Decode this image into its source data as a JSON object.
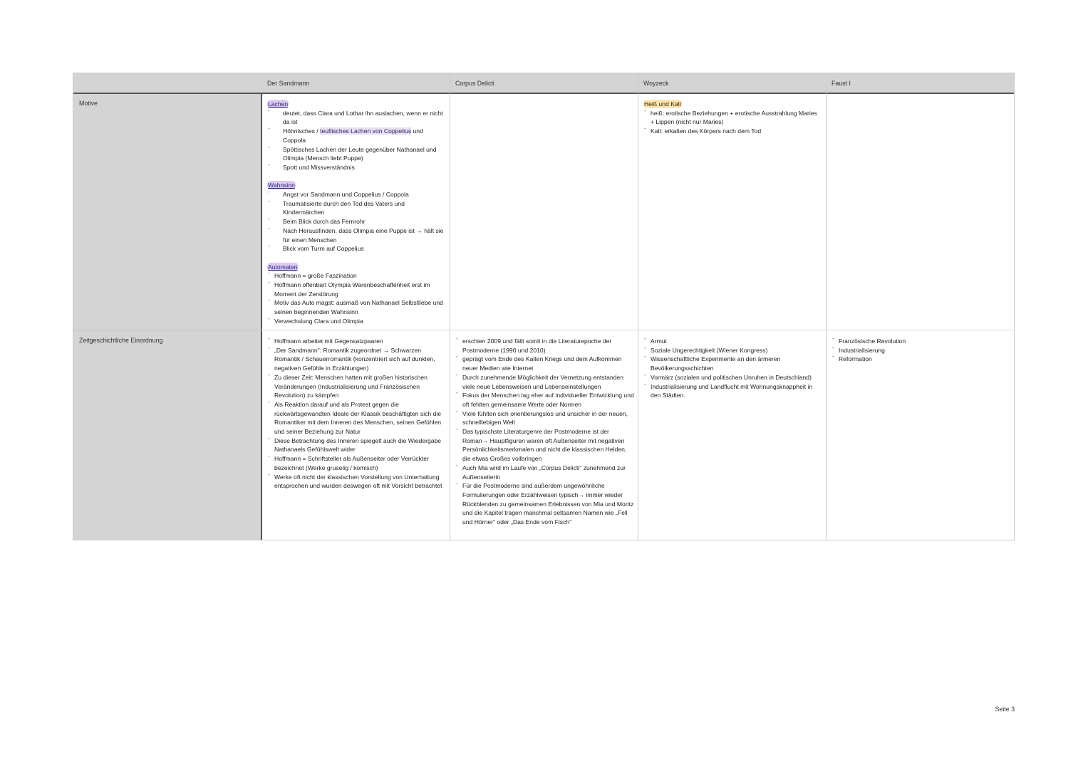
{
  "table": {
    "columns": [
      "Der Sandmann",
      "Corpus Delicti",
      "Woyzeck",
      "Faust I"
    ],
    "rows": [
      {
        "label": "Motive"
      },
      {
        "label": "Zeitgeschichtliche Einordnung"
      }
    ]
  },
  "motive": {
    "sandmann": {
      "lachen": {
        "title": "Lachen",
        "items": [
          "deutet, dass Clara und Lothar ihn auslachen, wenn er nicht da ist",
          "Spöttisches Lachen der Leute gegenüber Nathanael und Olimpia (Mensch liebt Puppe)",
          "Spott und Missverständnis"
        ],
        "item2_pre": "Höhnisches / ",
        "item2_hl": "teuflisches Lachen von Coppelius",
        "item2_post": " und Coppola"
      },
      "wahnsinn": {
        "title": "Wahnsinn",
        "items": [
          "Angst vor Sandmann und Coppelius / Coppola",
          "Traumatisierte durch den Tod des Vaters und Kindermärchen",
          "Beim Blick durch das Fernrohr",
          "Nach Herausfinden, dass Olimpia eine Puppe ist → hält sie für einen Menschen",
          "Blick vom Turm auf Coppelius"
        ]
      },
      "automaten": {
        "title": "Automaten",
        "items": [
          "Hoffmann = große Faszination",
          "Hoffmann offenbart Olympia Warenbeschaffenheit erst im Moment der Zerstörung",
          "Motiv das Auto magst: ausmaß von Nathanael Selbstliebe und seinen beginnenden Wahnsinn",
          "Verwechslung Clara und Olimpia"
        ]
      }
    },
    "woyzeck": {
      "title": "Heiß und Kalt",
      "items": [
        "heiß: erotische Beziehungen + erotische Ausstrahlung Maries + Lippen (nicht nur Maries)",
        "Kalt: erkalten des Körpers nach dem Tod"
      ]
    }
  },
  "einordnung": {
    "sandmann": [
      "Hoffmann arbeitet mit Gegensatzpaaren",
      "„Der Sandmann\": Romantik zugeordnet → Schwarzen Romantik / Schauerromantik (konzentriert sich auf dunklen, negativen Gefühle in Erzählungen)",
      "Zu dieser Zeit: Menschen hatten mit großen historischen Veränderungen (Industrialisierung und Französischen Revolution) zu kämpfen",
      "Als Reaktion darauf und als Protest gegen die rückwärtsgewandten Ideale der Klassik beschäftigten sich die Romantiker mit dem Inneren des Menschen, seinen Gefühlen und seiner Beziehung zur Natur",
      "Diese Betrachtung des Inneren spiegelt auch die Wiedergabe Nathanaels Gefühlswelt wider",
      "Hoffmann = Schriftsteller als Außenseiter oder Verrückter bezeichnet (Werke gruselig / komisch)",
      "Werke oft nicht der klassischen Vorstellung von Unterhaltung entsprochen und wurden deswegen oft mit Vorsicht betrachtet"
    ],
    "corpus": [
      "erschien 2009 und fällt somit in die Literaturepoche der Postmoderne (1990 und 2010)",
      "geprägt vom Ende des Kalten Kriegs und dem Aufkommen neuer Medien wie Internet",
      "Durch zunehmende Möglichkeit der Vernetzung entstanden viele neue Lebensweisen und Lebenseinstellungen",
      "Fokus der Menschen lag eher auf individueller Entwicklung und oft fehlten gemeinsame Werte oder Normen",
      "Viele fühlten sich orientierungslos und unsicher in der neuen, schnelllebigen Welt",
      "Das typischste Literaturgenre der Postmoderne ist der Roman→ Hauptfiguren waren oft Außenseiter mit negativen Persönlichkeitsmerkmalen und nicht die klassischen Helden, die etwas Großes vollbringen",
      "Auch Mia wird im Laufe von „Corpus Delicti\" zunehmend zur Außenseiterin",
      "Für die Postmoderne sind außerdem ungewöhnliche Formulierungen oder Erzählweisen typisch→ immer wieder Rückblenden zu gemeinsamen Erlebnissen von Mia und Moritz und die Kapitel tragen manchmal seltsamen Namen wie „Fell und Hörner\" oder „Das Ende vom Fisch\""
    ],
    "woyzeck": [
      "Armut",
      "Soziale Ungerechtigkeit (Wiener Kongress)",
      "Wissenschaftliche Experimente an den ärmeren Bevölkerungsschichten",
      "Vormärz (sozialen und politischen Unruhen in Deutschland)",
      "Industrialisierung und Landflucht mit Wohnungsknappheit in den Städten."
    ],
    "faust": [
      "Französische Revolution",
      "Industrialisierung",
      "Reformation"
    ]
  },
  "footer": {
    "page": "Seite 3"
  }
}
